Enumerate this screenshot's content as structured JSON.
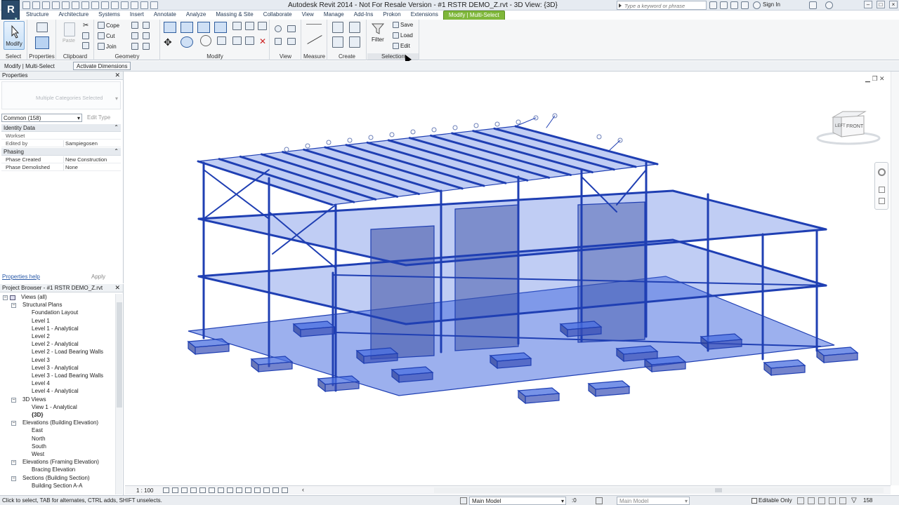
{
  "titlebar": {
    "title": "Autodesk Revit 2014 -  Not For Resale Version -     #1 RSTR DEMO_Z.rvt - 3D View: {3D}",
    "search_placeholder": "Type a keyword or phrase",
    "sign_in": "Sign In"
  },
  "tabs": [
    "Structure",
    "Architecture",
    "Systems",
    "Insert",
    "Annotate",
    "Analyze",
    "Massing & Site",
    "Collaborate",
    "View",
    "Manage",
    "Add-Ins",
    "Prokon",
    "Extensions",
    "Modify | Multi-Select"
  ],
  "ribbon": {
    "select": {
      "modify_label": "Modify",
      "panel_label": "Select"
    },
    "properties": {
      "panel_label": "Properties"
    },
    "clipboard": {
      "paste_label": "Paste",
      "panel_label": "Clipboard"
    },
    "geometry": {
      "cope_label": "Cope",
      "cut_label": "Cut",
      "join_label": "Join",
      "panel_label": "Geometry"
    },
    "modify": {
      "panel_label": "Modify"
    },
    "view": {
      "panel_label": "View"
    },
    "measure": {
      "panel_label": "Measure"
    },
    "create": {
      "panel_label": "Create"
    },
    "selection": {
      "filter_label": "Filter",
      "save_label": "Save",
      "load_label": "Load",
      "edit_label": "Edit",
      "panel_label": "Selection"
    }
  },
  "options_bar": {
    "context": "Modify | Multi-Select",
    "activate_dimensions": "Activate Dimensions"
  },
  "properties_palette": {
    "title": "Properties",
    "type_selector": "Multiple Categories Selected",
    "filter": "Common (158)",
    "edit_type": "Edit Type",
    "groups": [
      {
        "name": "Identity Data",
        "rows": [
          {
            "key": "Workset",
            "value": ""
          },
          {
            "key": "Edited by",
            "value": "Sampiegosen"
          }
        ]
      },
      {
        "name": "Phasing",
        "rows": [
          {
            "key": "Phase Created",
            "value": "New Construction"
          },
          {
            "key": "Phase Demolished",
            "value": "None"
          }
        ]
      }
    ],
    "help_link": "Properties help",
    "apply": "Apply"
  },
  "project_browser": {
    "title": "Project Browser - #1 RSTR DEMO_Z.rvt",
    "nodes": [
      {
        "label": "Views (all)",
        "level": 0,
        "toggle": "-",
        "bold": false
      },
      {
        "label": "Structural Plans",
        "level": 1,
        "toggle": "-",
        "bold": false
      },
      {
        "label": "Foundation Layout",
        "level": 2,
        "toggle": "",
        "bold": false
      },
      {
        "label": "Level 1",
        "level": 2,
        "toggle": "",
        "bold": false
      },
      {
        "label": "Level 1 - Analytical",
        "level": 2,
        "toggle": "",
        "bold": false
      },
      {
        "label": "Level 2",
        "level": 2,
        "toggle": "",
        "bold": false
      },
      {
        "label": "Level 2 - Analytical",
        "level": 2,
        "toggle": "",
        "bold": false
      },
      {
        "label": "Level 2 - Load Bearing Walls",
        "level": 2,
        "toggle": "",
        "bold": false
      },
      {
        "label": "Level 3",
        "level": 2,
        "toggle": "",
        "bold": false
      },
      {
        "label": "Level 3 - Analytical",
        "level": 2,
        "toggle": "",
        "bold": false
      },
      {
        "label": "Level 3 - Load Bearing Walls",
        "level": 2,
        "toggle": "",
        "bold": false
      },
      {
        "label": "Level 4",
        "level": 2,
        "toggle": "",
        "bold": false
      },
      {
        "label": "Level 4 - Analytical",
        "level": 2,
        "toggle": "",
        "bold": false
      },
      {
        "label": "3D Views",
        "level": 1,
        "toggle": "-",
        "bold": false
      },
      {
        "label": "View 1 - Analytical",
        "level": 2,
        "toggle": "",
        "bold": false
      },
      {
        "label": "{3D}",
        "level": 2,
        "toggle": "",
        "bold": true
      },
      {
        "label": "Elevations (Building Elevation)",
        "level": 1,
        "toggle": "-",
        "bold": false
      },
      {
        "label": "East",
        "level": 2,
        "toggle": "",
        "bold": false
      },
      {
        "label": "North",
        "level": 2,
        "toggle": "",
        "bold": false
      },
      {
        "label": "South",
        "level": 2,
        "toggle": "",
        "bold": false
      },
      {
        "label": "West",
        "level": 2,
        "toggle": "",
        "bold": false
      },
      {
        "label": "Elevations (Framing Elevation)",
        "level": 1,
        "toggle": "-",
        "bold": false
      },
      {
        "label": "Bracing Elevation",
        "level": 2,
        "toggle": "",
        "bold": false
      },
      {
        "label": "Sections (Building Section)",
        "level": 1,
        "toggle": "-",
        "bold": false
      },
      {
        "label": "Building Section A-A",
        "level": 2,
        "toggle": "",
        "bold": false
      }
    ]
  },
  "viewcube": {
    "left": "LEFT",
    "front": "FRONT"
  },
  "view_bar": {
    "scale": "1 : 100"
  },
  "status_bar": {
    "hint": "Click to select, TAB for alternates, CTRL adds, SHIFT unselects.",
    "workset": "Main Model",
    "active_count": ":0",
    "design_option": "Main Model",
    "editable_only": "Editable Only",
    "selected_count": "158"
  },
  "colors": {
    "accent_tab": "#7fb73a",
    "model_fill": "#4a6fe0",
    "model_stroke": "#1f3fb3"
  }
}
